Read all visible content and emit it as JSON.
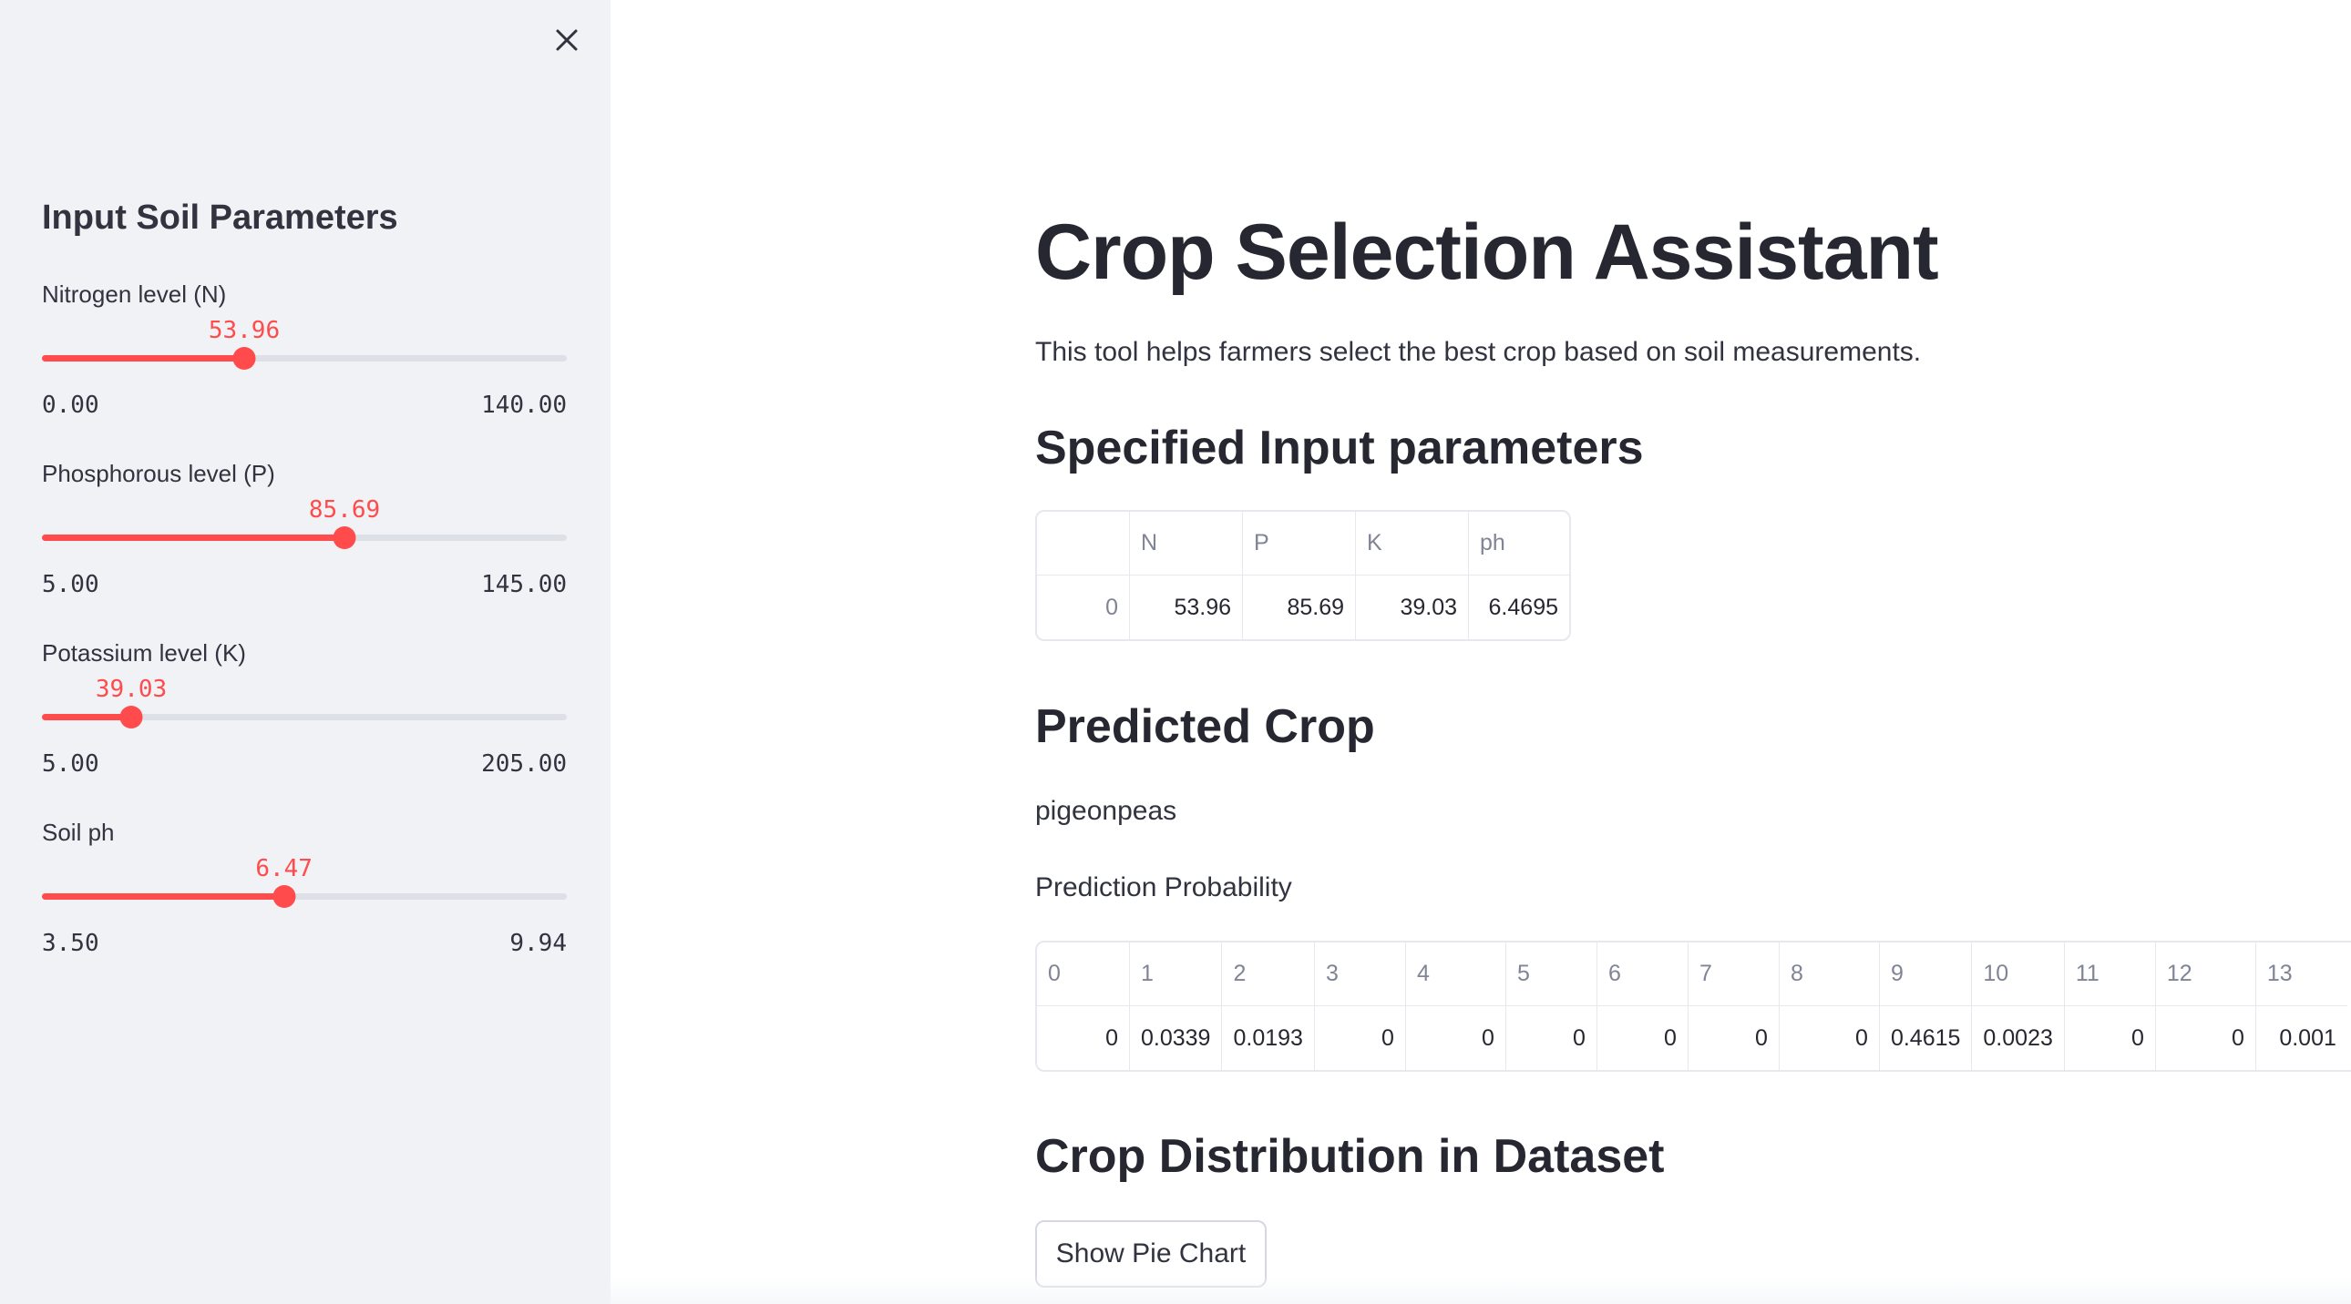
{
  "sidebar": {
    "heading": "Input Soil Parameters",
    "sliders": [
      {
        "label": "Nitrogen level (N)",
        "value": "53.96",
        "min": "0.00",
        "max": "140.00",
        "fraction": 0.3854
      },
      {
        "label": "Phosphorous level (P)",
        "value": "85.69",
        "min": "5.00",
        "max": "145.00",
        "fraction": 0.5764
      },
      {
        "label": "Potassium level (K)",
        "value": "39.03",
        "min": "5.00",
        "max": "205.00",
        "fraction": 0.1702
      },
      {
        "label": "Soil ph",
        "value": "6.47",
        "min": "3.50",
        "max": "9.94",
        "fraction": 0.4612
      }
    ],
    "accent_color": "#ff4b4b",
    "close_icon": "close-icon"
  },
  "main": {
    "title": "Crop Selection Assistant",
    "description": "This tool helps farmers select the best crop based on soil measurements.",
    "input_heading": "Specified Input parameters",
    "input_table": {
      "columns": [
        "",
        "N",
        "P",
        "K",
        "ph"
      ],
      "rows": [
        [
          "0",
          "53.96",
          "85.69",
          "39.03",
          "6.4695"
        ]
      ]
    },
    "predicted_heading": "Predicted Crop",
    "predicted_crop": "pigeonpeas",
    "probability_label": "Prediction Probability",
    "probability_table": {
      "columns": [
        "0",
        "1",
        "2",
        "3",
        "4",
        "5",
        "6",
        "7",
        "8",
        "9",
        "10",
        "11",
        "12",
        "13"
      ],
      "rows": [
        [
          "0",
          "0.0339",
          "0.0193",
          "0",
          "0",
          "0",
          "0",
          "0",
          "0",
          "0.4615",
          "0.0023",
          "0",
          "0",
          "0.001"
        ]
      ]
    },
    "distribution_heading": "Crop Distribution in Dataset",
    "pie_button_label": "Show Pie Chart"
  }
}
